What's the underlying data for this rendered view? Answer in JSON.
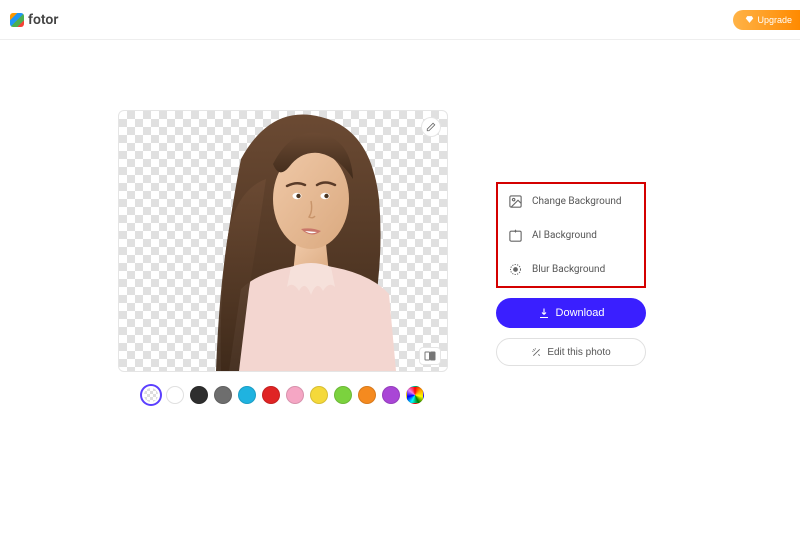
{
  "header": {
    "brand": "fotor",
    "upgrade_label": "Upgrade"
  },
  "bg_options": {
    "change": "Change Background",
    "ai": "AI Background",
    "blur": "Blur Background"
  },
  "actions": {
    "download": "Download",
    "edit": "Edit this photo"
  },
  "swatches": [
    {
      "name": "transparent",
      "style": "transparent",
      "selected": true
    },
    {
      "name": "white",
      "style": "white",
      "selected": false
    },
    {
      "name": "black",
      "color": "#2e2e2e",
      "selected": false
    },
    {
      "name": "gray",
      "color": "#6e6e6e",
      "selected": false
    },
    {
      "name": "cyan",
      "color": "#1fb3e0",
      "selected": false
    },
    {
      "name": "red",
      "color": "#e02424",
      "selected": false
    },
    {
      "name": "pink",
      "color": "#f5a6c4",
      "selected": false
    },
    {
      "name": "yellow",
      "color": "#f5d93a",
      "selected": false
    },
    {
      "name": "green",
      "color": "#7bd23e",
      "selected": false
    },
    {
      "name": "orange",
      "color": "#f58a1f",
      "selected": false
    },
    {
      "name": "purple",
      "color": "#a946d6",
      "selected": false
    },
    {
      "name": "rainbow",
      "style": "rainbow",
      "selected": false
    }
  ]
}
